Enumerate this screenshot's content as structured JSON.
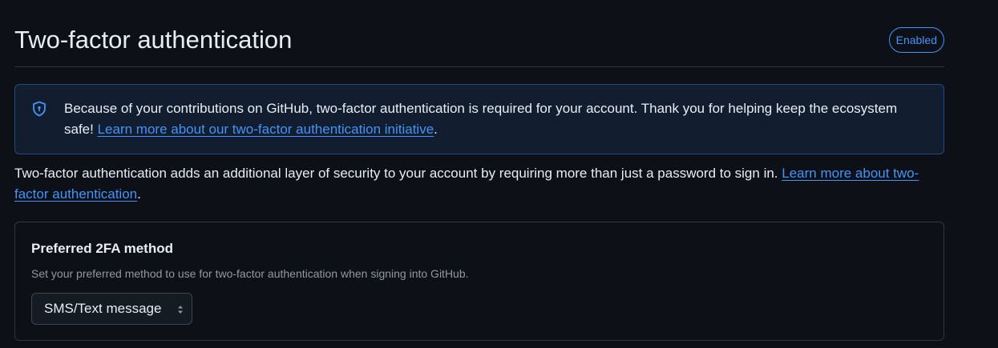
{
  "header": {
    "title": "Two-factor authentication",
    "status_badge": "Enabled"
  },
  "notice": {
    "icon": "shield-lock-icon",
    "text": "Because of your contributions on GitHub, two-factor authentication is required for your account. Thank you for helping keep the ecosystem safe! ",
    "link_text": "Learn more about our two-factor authentication initiative",
    "suffix": "."
  },
  "description": {
    "text": "Two-factor authentication adds an additional layer of security to your account by requiring more than just a password to sign in. ",
    "link_text": "Learn more about two-factor authentication",
    "suffix": "."
  },
  "preferred_method": {
    "title": "Preferred 2FA method",
    "description": "Set your preferred method to use for two-factor authentication when signing into GitHub.",
    "selected": "SMS/Text message",
    "select_icon": "select-arrows-icon"
  },
  "colors": {
    "background": "#0d1117",
    "accent": "#4493f8",
    "notice_bg": "#121d2f",
    "border": "#30363d"
  }
}
